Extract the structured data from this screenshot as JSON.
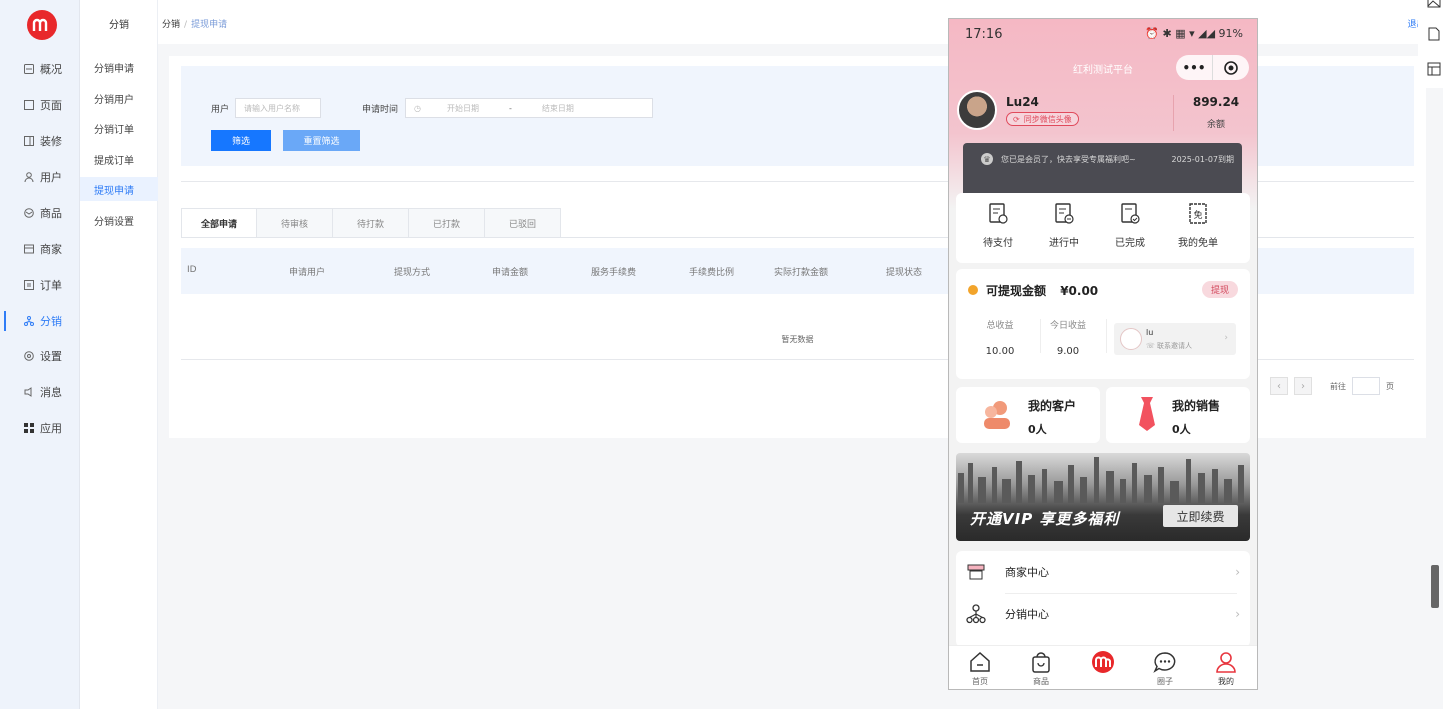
{
  "rail": {
    "logo": "m",
    "items": [
      {
        "label": "概况",
        "icon": "overview-icon"
      },
      {
        "label": "页面",
        "icon": "page-icon"
      },
      {
        "label": "装修",
        "icon": "decorate-icon"
      },
      {
        "label": "用户",
        "icon": "user-icon"
      },
      {
        "label": "商品",
        "icon": "product-icon"
      },
      {
        "label": "商家",
        "icon": "merchant-icon"
      },
      {
        "label": "订单",
        "icon": "order-icon"
      },
      {
        "label": "分销",
        "icon": "distribution-icon"
      },
      {
        "label": "设置",
        "icon": "settings-icon"
      },
      {
        "label": "消息",
        "icon": "message-icon"
      },
      {
        "label": "应用",
        "icon": "apps-icon"
      }
    ]
  },
  "submenu": {
    "title": "分销",
    "items": [
      "分销申请",
      "分销用户",
      "分销订单",
      "提成订单",
      "提现申请",
      "分销设置"
    ]
  },
  "topbar": {
    "crumb_root": "分销",
    "crumb_sep": "/",
    "crumb_current": "提现申请",
    "logout": "退出 ∨"
  },
  "filter": {
    "user_label": "用户",
    "user_placeholder": "请输入用户名称",
    "time_label": "申请时间",
    "date_start": "开始日期",
    "date_dash": "-",
    "date_end": "结束日期",
    "filter_btn": "筛选",
    "reset_btn": "重置筛选"
  },
  "tabs": [
    "全部申请",
    "待审核",
    "待打款",
    "已打款",
    "已驳回"
  ],
  "table": {
    "headers": [
      "ID",
      "申请用户",
      "提现方式",
      "申请金额",
      "服务手续费",
      "手续费比例",
      "实际打款金额",
      "提现状态"
    ],
    "empty": "暂无数据"
  },
  "pager": {
    "prev": "‹",
    "next": "›",
    "goto": "前往",
    "page": "页"
  },
  "phone": {
    "time": "17:16",
    "status_right": "⏰ ✱ ▦ ▾ ◢◢ 91%",
    "mini_title": "红利测试平台",
    "capsule_more": "•••",
    "user_name": "Lu24",
    "sync_label": "同步微信头像",
    "balance": "899.24",
    "balance_label": "余额",
    "vip_text": "您已是会员了，快去享受专属福利吧~",
    "vip_date": "2025-01-07到期",
    "orders": [
      {
        "label": "待支付"
      },
      {
        "label": "进行中"
      },
      {
        "label": "已完成"
      },
      {
        "label": "我的免单"
      }
    ],
    "withdraw_title": "可提现金额",
    "withdraw_amount": "¥0.00",
    "withdraw_btn": "提现",
    "total_label": "总收益",
    "total_value": "10.00",
    "today_label": "今日收益",
    "today_value": "9.00",
    "inviter_name": "lu",
    "inviter_contact": "联系邀请人",
    "customers_title": "我的客户",
    "customers_value": "0人",
    "sales_title": "我的销售",
    "sales_value": "0人",
    "banner_text": "开通VIP 享更多福利",
    "banner_btn": "立即续费",
    "menu": [
      {
        "label": "商家中心"
      },
      {
        "label": "分销中心"
      }
    ],
    "tabbar": [
      "首页",
      "商品",
      "",
      "圈子",
      "我的"
    ]
  },
  "colors": {
    "primary": "#2f7cf6",
    "brand_red": "#e8282b",
    "pink_head": "#f5b8c4"
  }
}
